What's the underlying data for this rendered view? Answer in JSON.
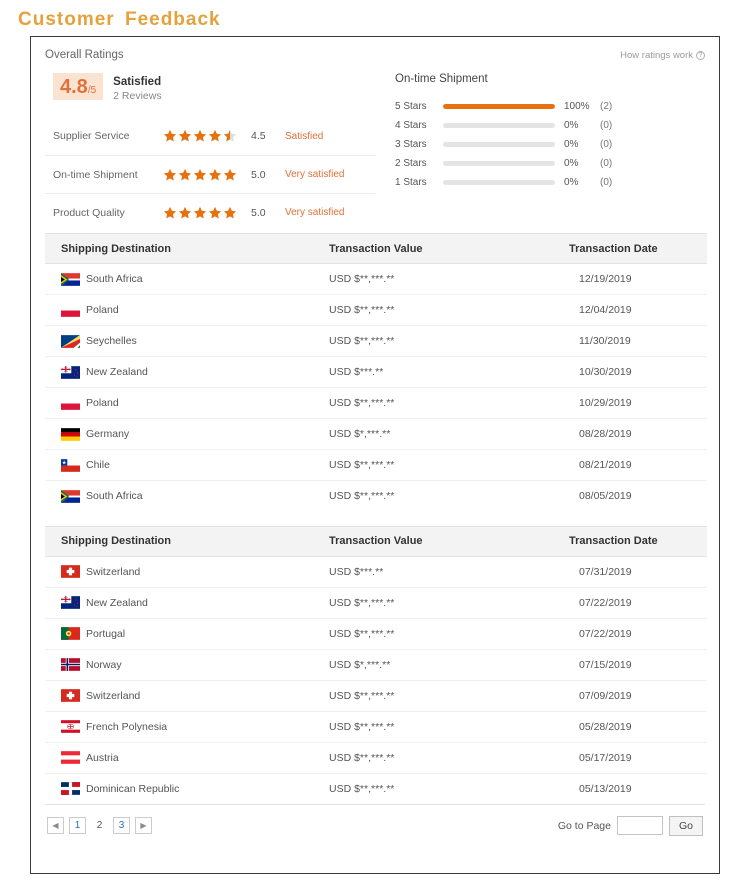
{
  "page": {
    "title": "Customer  Feedback"
  },
  "ratings": {
    "section_label": "Overall Ratings",
    "how_link": "How ratings work",
    "how_icon": "question-circle-icon",
    "score": "4.8",
    "score_suffix": "/5",
    "score_title": "Satisfied",
    "reviews": "2 Reviews",
    "rows": [
      {
        "name": "Supplier Service",
        "stars": 4.5,
        "score": "4.5",
        "word": "Satisfied"
      },
      {
        "name": "On-time Shipment",
        "stars": 5,
        "score": "5.0",
        "word": "Very satisfied"
      },
      {
        "name": "Product Quality",
        "stars": 5,
        "score": "5.0",
        "word": "Very satisfied"
      }
    ]
  },
  "chart_data": {
    "type": "bar",
    "title": "On-time Shipment",
    "xlabel": "",
    "ylabel": "",
    "categories": [
      "5 Stars",
      "4 Stars",
      "3 Stars",
      "2 Stars",
      "1 Stars"
    ],
    "values": [
      100,
      0,
      0,
      0,
      0
    ],
    "counts": [
      2,
      0,
      0,
      0,
      0
    ],
    "pct_labels": [
      "100%",
      "0%",
      "0%",
      "0%",
      "0%"
    ],
    "count_labels": [
      "(2)",
      "(0)",
      "(0)",
      "(0)",
      "(0)"
    ],
    "xlim": [
      0,
      100
    ],
    "grid": false,
    "legend": "none",
    "bar_color": "#E8700F",
    "track_color": "#E4E4E4"
  },
  "tables": [
    {
      "columns": [
        "Shipping Destination",
        "Transaction Value",
        "Transaction Date"
      ],
      "rows": [
        {
          "country": "South Africa",
          "flag": "flag-za",
          "value": "USD $**,***.**",
          "date": "12/19/2019"
        },
        {
          "country": "Poland",
          "flag": "flag-pl",
          "value": "USD $**,***.**",
          "date": "12/04/2019"
        },
        {
          "country": "Seychelles",
          "flag": "flag-sc",
          "value": "USD $**,***.**",
          "date": "11/30/2019"
        },
        {
          "country": "New Zealand",
          "flag": "flag-nz",
          "value": "USD $***.**",
          "date": "10/30/2019"
        },
        {
          "country": "Poland",
          "flag": "flag-pl",
          "value": "USD $**,***.**",
          "date": "10/29/2019"
        },
        {
          "country": "Germany",
          "flag": "flag-de",
          "value": "USD $*,***.**",
          "date": "08/28/2019"
        },
        {
          "country": "Chile",
          "flag": "flag-cl",
          "value": "USD $**,***.**",
          "date": "08/21/2019"
        },
        {
          "country": "South Africa",
          "flag": "flag-za",
          "value": "USD $**,***.**",
          "date": "08/05/2019"
        }
      ]
    },
    {
      "columns": [
        "Shipping Destination",
        "Transaction Value",
        "Transaction Date"
      ],
      "rows": [
        {
          "country": "Switzerland",
          "flag": "flag-ch",
          "value": "USD $***.**",
          "date": "07/31/2019"
        },
        {
          "country": "New Zealand",
          "flag": "flag-nz",
          "value": "USD $**,***.**",
          "date": "07/22/2019"
        },
        {
          "country": "Portugal",
          "flag": "flag-pt",
          "value": "USD $**,***.**",
          "date": "07/22/2019"
        },
        {
          "country": "Norway",
          "flag": "flag-no",
          "value": "USD $*,***.**",
          "date": "07/15/2019"
        },
        {
          "country": "Switzerland",
          "flag": "flag-ch",
          "value": "USD $**,***.**",
          "date": "07/09/2019"
        },
        {
          "country": "French Polynesia",
          "flag": "flag-pf",
          "value": "USD $**,***.**",
          "date": "05/28/2019"
        },
        {
          "country": "Austria",
          "flag": "flag-at",
          "value": "USD $**,***.**",
          "date": "05/17/2019"
        },
        {
          "country": "Dominican Republic",
          "flag": "flag-do",
          "value": "USD $**,***.**",
          "date": "05/13/2019"
        }
      ]
    }
  ],
  "pagination": {
    "prev_icon": "chevron-left-icon",
    "next_icon": "chevron-right-icon",
    "pages": [
      "1",
      "2",
      "3"
    ],
    "active_page": "2",
    "goto_label": "Go to Page",
    "goto_value": "",
    "goto_placeholder": "",
    "go_label": "Go"
  },
  "colors": {
    "accent": "#E8700F",
    "title": "#E5A23C",
    "score_bg": "#FBE3D2"
  }
}
